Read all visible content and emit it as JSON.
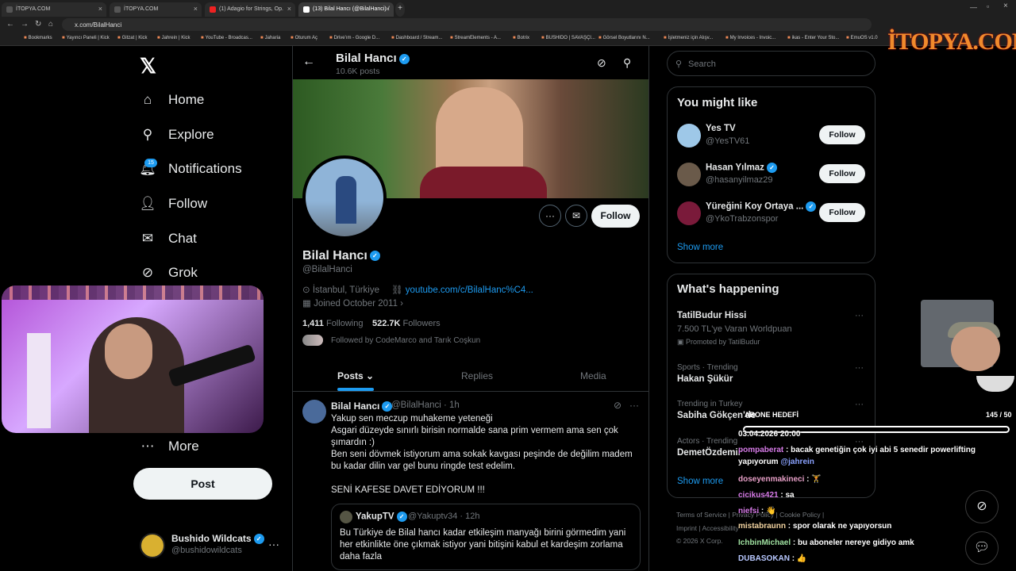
{
  "browser": {
    "tabs": [
      {
        "label": "İTOPYA.COM"
      },
      {
        "label": "İTOPYA.COM"
      },
      {
        "label": "(1) Adagio for Strings, Op."
      },
      {
        "label": "(13) Bilal Hancı (@BilalHanci) /"
      }
    ],
    "url": "x.com/BilalHanci",
    "bookmarks": [
      "Bookmarks",
      "Yayıncı Paneli | Kick",
      "Gitzat | Kick",
      "Jahrein | Kick",
      "YouTube - Broadcas...",
      "Jaharia",
      "Oturum Aç",
      "Drive'ım - Google D...",
      "Dashboard / Stream...",
      "StreamElements - A...",
      "Botrix",
      "BUSHIDO | SAVAŞÇI...",
      "Görsel Boyutlarını N...",
      "İşletmeniz için Alışv...",
      "My Invoices - Invoic...",
      "ikas - Enter Your Sto...",
      "EmuOS v1.0"
    ]
  },
  "overlay_logo": "İTOPYA.COM",
  "left_nav": {
    "items": [
      {
        "label": "Home",
        "icon": "home-icon"
      },
      {
        "label": "Explore",
        "icon": "search-icon"
      },
      {
        "label": "Notifications",
        "icon": "bell-icon"
      },
      {
        "label": "Follow",
        "icon": "add-person-icon"
      },
      {
        "label": "Chat",
        "icon": "mail-icon"
      },
      {
        "label": "Grok",
        "icon": "grok-icon"
      },
      {
        "label": "More",
        "icon": "more-circle-icon"
      }
    ],
    "notif_badge": "15",
    "post_label": "Post",
    "account": {
      "name": "Bushido Wildcats",
      "handle": "@bushidowildcats"
    }
  },
  "profile": {
    "header_name": "Bilal Hancı",
    "header_posts": "10.6K posts",
    "name": "Bilal Hancı",
    "handle": "@BilalHanci",
    "location": "İstanbul, Türkiye",
    "link": "youtube.com/c/BilalHanc%C4...",
    "joined": "Joined October 2011",
    "following_count": "1,411",
    "following_label": "Following",
    "followers_count": "522.7K",
    "followers_label": "Followers",
    "followed_by": "Followed by CodeMarco and Tarık Coşkun",
    "follow_label": "Follow",
    "tabs": [
      "Posts",
      "Replies",
      "Media"
    ]
  },
  "tweet": {
    "name": "Bilal Hancı",
    "handle": "@BilalHanci",
    "time": "· 1h",
    "lines": [
      "Yakup sen meczup muhakeme yeteneği",
      "Asgari düzeyde sınırlı birisin normalde sana prim vermem ama sen çok",
      "şımardın :)",
      "Ben seni dövmek istiyorum ama sokak kavgası peşinde de değilim madem",
      "bu kadar dilin var gel bunu ringde test edelim.",
      "",
      "SENİ KAFESE DAVET EDİYORUM !!!"
    ],
    "quote": {
      "name": "YakupTV",
      "handle": "@Yakuptv34",
      "time": "· 12h",
      "lines": [
        "Bu Türkiye de Bilal hancı kadar etkileşim manyağı birini görmedim yani",
        "her etkinlikte öne çıkmak istiyor yani bitişini kabul et kardeşim zorlama",
        "daha fazla"
      ]
    }
  },
  "sidebar": {
    "search_placeholder": "Search",
    "you_might_like": "You might like",
    "suggestions": [
      {
        "name": "Yes TV",
        "handle": "@YesTV61",
        "verified": false,
        "color": "#9ec8e8"
      },
      {
        "name": "Hasan Yılmaz",
        "handle": "@hasanyilmaz29",
        "verified": true,
        "color": "#6a5a4a"
      },
      {
        "name": "Yüreğini Koy Ortaya ...",
        "handle": "@YkoTrabzonspor",
        "verified": true,
        "color": "#7a1a3a"
      }
    ],
    "follow_label": "Follow",
    "show_more": "Show more",
    "whats_happening": "What's happening",
    "trends": [
      {
        "context": "",
        "title": "TatilBudur Hissi",
        "sub": "7.500 TL'ye Varan Worldpuan",
        "promo": "Promoted by TatilBudur"
      },
      {
        "context": "Sports · Trending",
        "title": "Hakan Şükür"
      },
      {
        "context": "Trending in Turkey",
        "title": "Sabiha Gökçen'de"
      },
      {
        "context": "Actors · Trending",
        "title": "DemetÖzdemir"
      }
    ],
    "footer": [
      "Terms of Service",
      "Privacy Policy",
      "Cookie Policy",
      "Imprint",
      "Accessibility",
      "© 2026 X Corp."
    ]
  },
  "stream_overlay": {
    "goal_title": "ABONE HEDEFİ",
    "goal_count": "145 / 50",
    "goal_date": "03.04.2026 20:00",
    "chat": [
      {
        "user": "pompaberat",
        "msg": " : bacak genetiğin çok iyi abi 5 senedir powerlifting yapıyorum ",
        "mention": "@jahrein"
      },
      {
        "user": "doseyenmakineci",
        "msg": " : 🏋",
        "mention": ""
      },
      {
        "user": "cicikus421",
        "msg": " : sa",
        "mention": ""
      },
      {
        "user": "niefsi",
        "msg": " : 👋",
        "mention": ""
      },
      {
        "user": "mistabraunn",
        "msg": " : spor olarak ne yapıyorsun",
        "mention": ""
      },
      {
        "user": "IchbinMichael",
        "msg": " : bu aboneler nereye gidiyo amk",
        "mention": ""
      },
      {
        "user": "DUBASOKAN",
        "msg": " : 👍",
        "mention": ""
      }
    ]
  }
}
